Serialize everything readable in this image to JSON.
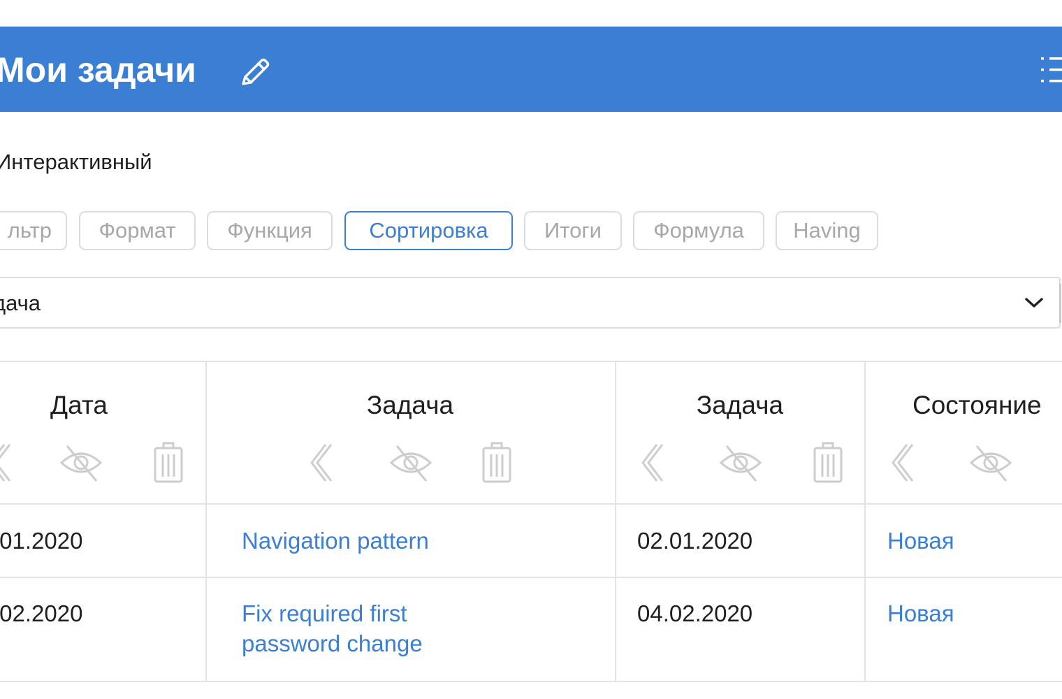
{
  "header": {
    "title": "Мои задачи",
    "accent": "#3b7fd4"
  },
  "report": {
    "mode": "Интерактивный"
  },
  "tabs": [
    {
      "label": "льтр",
      "active": false
    },
    {
      "label": "Формат",
      "active": false
    },
    {
      "label": "Функция",
      "active": false
    },
    {
      "label": "Сортировка",
      "active": true
    },
    {
      "label": "Итоги",
      "active": false
    },
    {
      "label": "Формула",
      "active": false
    },
    {
      "label": "Having",
      "active": false
    }
  ],
  "sort_select": {
    "value": "дача"
  },
  "table": {
    "columns": [
      "Дата",
      "Задача",
      "Задача",
      "Состояние"
    ],
    "rows": [
      {
        "date": ".01.2020",
        "task": "Navigation pattern",
        "task_date": "02.01.2020",
        "status": "Новая"
      },
      {
        "date": ".02.2020",
        "task_line1": "Fix required first",
        "task_line2": "password change",
        "task_date": "04.02.2020",
        "status": "Новая"
      }
    ]
  },
  "colors": {
    "link": "#3b7fd4",
    "border": "#e3e3e3",
    "tab_border": "#dcdcdc",
    "inactive_text": "#a8a8a8"
  }
}
